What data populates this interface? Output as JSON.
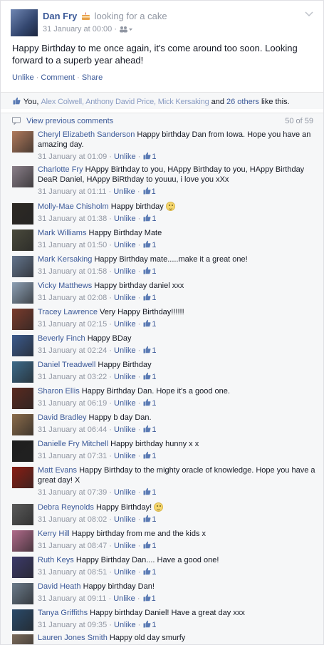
{
  "post": {
    "author": "Dan Fry",
    "activity": "looking for a cake",
    "timestamp": "31 January at 00:00",
    "text": "Happy Birthday to me once again, it's come around too soon. Looking forward to a superb year ahead!",
    "actions": {
      "unlike": "Unlike",
      "comment": "Comment",
      "share": "Share",
      "separator": "·"
    }
  },
  "likes": {
    "you": "You,",
    "names": "Alex Colwell, Anthony David Price, Mick Kersaking",
    "and": "and",
    "others_link": "26 others",
    "suffix": "like this."
  },
  "comments_header": {
    "view_previous": "View previous comments",
    "count": "50 of 59"
  },
  "comment_meta": {
    "unlike": "Unlike",
    "like_count": "1"
  },
  "comments": [
    {
      "author": "Cheryl Elizabeth Sanderson",
      "text": "Happy birthday Dan from Iowa. Hope you have an amazing day.",
      "time": "31 January at 01:09",
      "avatar": "#b07a5c"
    },
    {
      "author": "Charlotte Fry",
      "text": "HAppy Birthday to you, HAppy Birthday to you, HAppy Birthday DeaR Daniel, HAppy BiRthday to youuu, i love you xXx",
      "time": "31 January at 01:11",
      "avatar": "#8a7f89"
    },
    {
      "author": "Molly-Mae Chisholm",
      "text": "Happy birthday",
      "time": "31 January at 01:38",
      "avatar": "#2e2a25",
      "smiley": true
    },
    {
      "author": "Mark Williams",
      "text": "Happy Birthday Mate",
      "time": "31 January at 01:50",
      "avatar": "#4a4a3c"
    },
    {
      "author": "Mark Kersaking",
      "text": "Happy Birthday mate.....make it a great one!",
      "time": "31 January at 01:58",
      "avatar": "#63748c"
    },
    {
      "author": "Vicky Matthews",
      "text": "Happy birthday daniel xxx",
      "time": "31 January at 02:08",
      "avatar": "#8c9fb4"
    },
    {
      "author": "Tracey Lawrence",
      "text": "Very Happy Birthday!!!!!!",
      "time": "31 January at 02:15",
      "avatar": "#7a3b2c"
    },
    {
      "author": "Beverly Finch",
      "text": "Happy BDay",
      "time": "31 January at 02:24",
      "avatar": "#3b5a8c"
    },
    {
      "author": "Daniel Treadwell",
      "text": "Happy Birthday",
      "time": "31 January at 03:22",
      "avatar": "#3c6a8a"
    },
    {
      "author": "Sharon Ellis",
      "text": "Happy Birthday Dan. Hope it's a good one.",
      "time": "31 January at 06:19",
      "avatar": "#5a2a20"
    },
    {
      "author": "David Bradley",
      "text": "Happy b day Dan.",
      "time": "31 January at 06:44",
      "avatar": "#8a6b4a"
    },
    {
      "author": "Danielle Fry Mitchell",
      "text": "Happy birthday hunny x x",
      "time": "31 January at 07:31",
      "avatar": "#1e1e1e"
    },
    {
      "author": "Matt Evans",
      "text": "Happy Birthday to the mighty oracle of knowledge. Hope you have a great day! X",
      "time": "31 January at 07:39",
      "avatar": "#8a1e14"
    },
    {
      "author": "Debra Reynolds",
      "text": "Happy Birthday!",
      "time": "31 January at 08:02",
      "avatar": "#5a5a5a",
      "smiley": true
    },
    {
      "author": "Kerry Hill",
      "text": "Happy birthday from me and the kids x",
      "time": "31 January at 08:47",
      "avatar": "#b06a8a"
    },
    {
      "author": "Ruth Keys",
      "text": "Happy Birthday Dan.... Have a good one!",
      "time": "31 January at 08:51",
      "avatar": "#3c3a6a"
    },
    {
      "author": "David Heath",
      "text": "Happy birthday Dan!",
      "time": "31 January at 09:11",
      "avatar": "#6a7a8a"
    },
    {
      "author": "Tanya Griffiths",
      "text": "Happy birthday Daniel! Have a great day xxx",
      "time": "31 January at 09:35",
      "avatar": "#2a4a6a"
    },
    {
      "author": "Lauren Jones Smith",
      "text": "Happy old day smurfy",
      "time": "",
      "avatar": "#7a6a5a"
    }
  ],
  "colors": {
    "link": "#3b5998",
    "meta": "#9197a3",
    "background": "#f6f7f8"
  },
  "icons": [
    "cake-icon",
    "audience-friends-icon",
    "chevron-down-icon",
    "thumb-up-icon",
    "comment-icon",
    "smiley-icon"
  ]
}
